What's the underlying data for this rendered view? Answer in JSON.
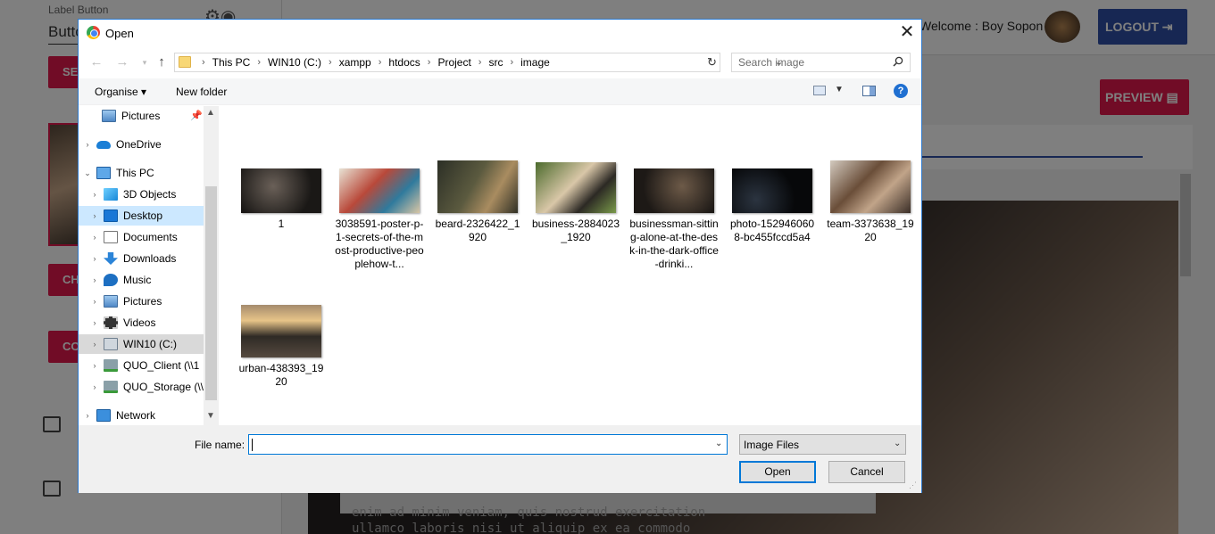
{
  "app": {
    "label_button_caption": "Label Button",
    "label_button_value": "Butto",
    "btn_select": "SE",
    "btn_change": "CH",
    "btn_confirm": "CO",
    "welcome": "Welcome : Boy Sopon",
    "logout": "LOGOUT",
    "preview": "PREVIEW",
    "code_text": "enim ad minim veniam, quis nostrud exercitation\nullamco laboris nisi ut aliquip ex ea commodo"
  },
  "dialog": {
    "title": "Open",
    "breadcrumb": [
      "This PC",
      "WIN10 (C:)",
      "xampp",
      "htdocs",
      "Project",
      "src",
      "image"
    ],
    "search_placeholder": "Search image",
    "toolbar": {
      "organise": "Organise",
      "new_folder": "New folder"
    },
    "nav_items": [
      {
        "label": "Pictures",
        "icon": "pictures-icon"
      },
      {
        "label": "OneDrive",
        "icon": "onedrive-icon"
      },
      {
        "label": "This PC",
        "icon": "this-pc-icon"
      },
      {
        "label": "3D Objects",
        "icon": "3d-objects-icon"
      },
      {
        "label": "Desktop",
        "icon": "desktop-icon"
      },
      {
        "label": "Documents",
        "icon": "documents-icon"
      },
      {
        "label": "Downloads",
        "icon": "downloads-icon"
      },
      {
        "label": "Music",
        "icon": "music-icon"
      },
      {
        "label": "Pictures",
        "icon": "pictures-icon"
      },
      {
        "label": "Videos",
        "icon": "videos-icon"
      },
      {
        "label": "WIN10 (C:)",
        "icon": "drive-icon"
      },
      {
        "label": "QUO_Client (\\\\1",
        "icon": "network-drive-icon"
      },
      {
        "label": "QUO_Storage (\\\\",
        "icon": "network-drive-icon"
      },
      {
        "label": "Network",
        "icon": "network-icon"
      }
    ],
    "files": [
      {
        "name": "1"
      },
      {
        "name": "3038591-poster-p-1-secrets-of-the-most-productive-peoplehow-t..."
      },
      {
        "name": "beard-2326422_1920"
      },
      {
        "name": "business-2884023_1920"
      },
      {
        "name": "businessman-sitting-alone-at-the-desk-in-the-dark-office-drinki..."
      },
      {
        "name": "photo-1529460608-bc455fccd5a4"
      },
      {
        "name": "team-3373638_1920"
      },
      {
        "name": "urban-438393_1920"
      }
    ],
    "file_name_label": "File name:",
    "file_name_value": "",
    "file_type": "Image Files",
    "open_button": "Open",
    "cancel_button": "Cancel"
  }
}
